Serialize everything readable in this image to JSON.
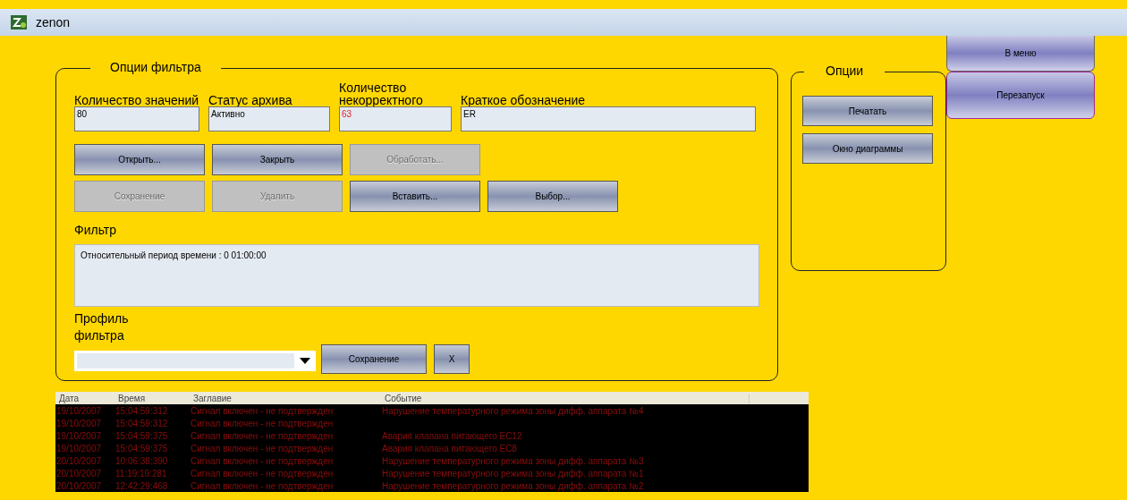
{
  "window": {
    "title": "zenon"
  },
  "filter_panel": {
    "title": "Опции фильтра",
    "fields": [
      {
        "label": "Количество значений",
        "value": "80",
        "alert": false
      },
      {
        "label": "Статус архива",
        "value": "Активно",
        "alert": false
      },
      {
        "label": "Количество некорректного",
        "value": "63",
        "alert": true
      },
      {
        "label": "Краткое обозначение",
        "value": "ER",
        "alert": false
      }
    ],
    "button_rows": [
      [
        {
          "label": "Открыть...",
          "disabled": false
        },
        {
          "label": "Закрыть",
          "disabled": false
        },
        {
          "label": "Обработать...",
          "disabled": true
        }
      ],
      [
        {
          "label": "Сохранение",
          "disabled": true
        },
        {
          "label": "Удалить",
          "disabled": true
        },
        {
          "label": "Вставить...",
          "disabled": false
        },
        {
          "label": "Выбор...",
          "disabled": false
        }
      ]
    ],
    "filter_label": "Фильтр",
    "filter_text": "Относительный период времени : 0  01:00:00",
    "profile_label": "Профиль фильтра",
    "profile_buttons": [
      "Сохранение",
      "X"
    ]
  },
  "options_panel": {
    "title": "Опции",
    "buttons": [
      "Печатать",
      "Окно диаграммы"
    ]
  },
  "side_buttons": [
    "В меню",
    "Перезапуск"
  ],
  "table": {
    "columns": [
      "Дата",
      "Время",
      "Заглавие",
      "Событие"
    ],
    "rows": [
      [
        "19/10/2007",
        "15:04:59:312",
        "Сигнал включен - не подтвержден",
        "Нарушение температурного режима зоны дифф. аппарата №4"
      ],
      [
        "19/10/2007",
        "15:04:59:312",
        "Сигнал включен - не подтвержден",
        ""
      ],
      [
        "19/10/2007",
        "15:04:59:375",
        "Сигнал включен - не подтвержден",
        "Авария клапана питающего ЕС12"
      ],
      [
        "19/10/2007",
        "15:04:59:375",
        "Сигнал включен - не подтвержден",
        "Авария клапана питающего ЕС8"
      ],
      [
        "20/10/2007",
        "10:06:38:390",
        "Сигнал включен - не подтвержден",
        "Нарушение температурного режима зоны дифф. аппарата №3"
      ],
      [
        "20/10/2007",
        "11:19:19:281",
        "Сигнал включен - не подтвержден",
        "Нарушение температурного режима зоны дифф. аппарата №1"
      ],
      [
        "20/10/2007",
        "12:42:29:468",
        "Сигнал включен - не подтвержден",
        "Нарушение температурного режима зоны дифф. аппарата №2"
      ]
    ]
  }
}
